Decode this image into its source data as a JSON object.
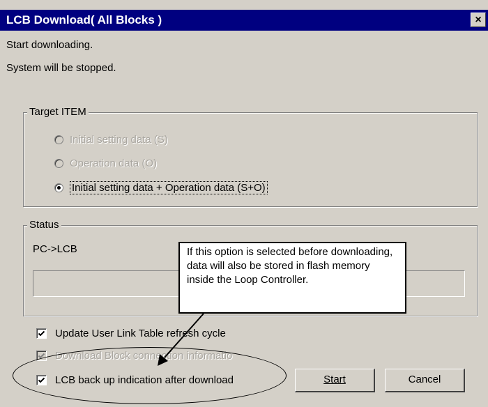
{
  "window": {
    "title": "LCB Download( All Blocks )",
    "close_glyph": "×"
  },
  "messages": {
    "line1": "Start downloading.",
    "line2": "System will be stopped."
  },
  "target_group": {
    "label": "Target ITEM",
    "options": [
      {
        "label": "Initial setting data (S)",
        "selected": false,
        "enabled": false
      },
      {
        "label": "Operation data (O)",
        "selected": false,
        "enabled": false
      },
      {
        "label": "Initial setting data + Operation data (S+O)",
        "selected": true,
        "enabled": true
      }
    ]
  },
  "status_group": {
    "label": "Status",
    "text": "PC->LCB",
    "progress": 0
  },
  "checkboxes": [
    {
      "label": "Update User Link Table refresh cycle",
      "checked": true,
      "enabled": true
    },
    {
      "label": "Download Block connection informatio",
      "checked": true,
      "enabled": false
    },
    {
      "label": "LCB back up indication after download",
      "checked": true,
      "enabled": true
    }
  ],
  "buttons": {
    "start_label": "Start",
    "cancel_label": "Cancel"
  },
  "callout": {
    "text": "If this option is selected before downloading, data will also be stored in flash memory inside the Loop Controller."
  }
}
